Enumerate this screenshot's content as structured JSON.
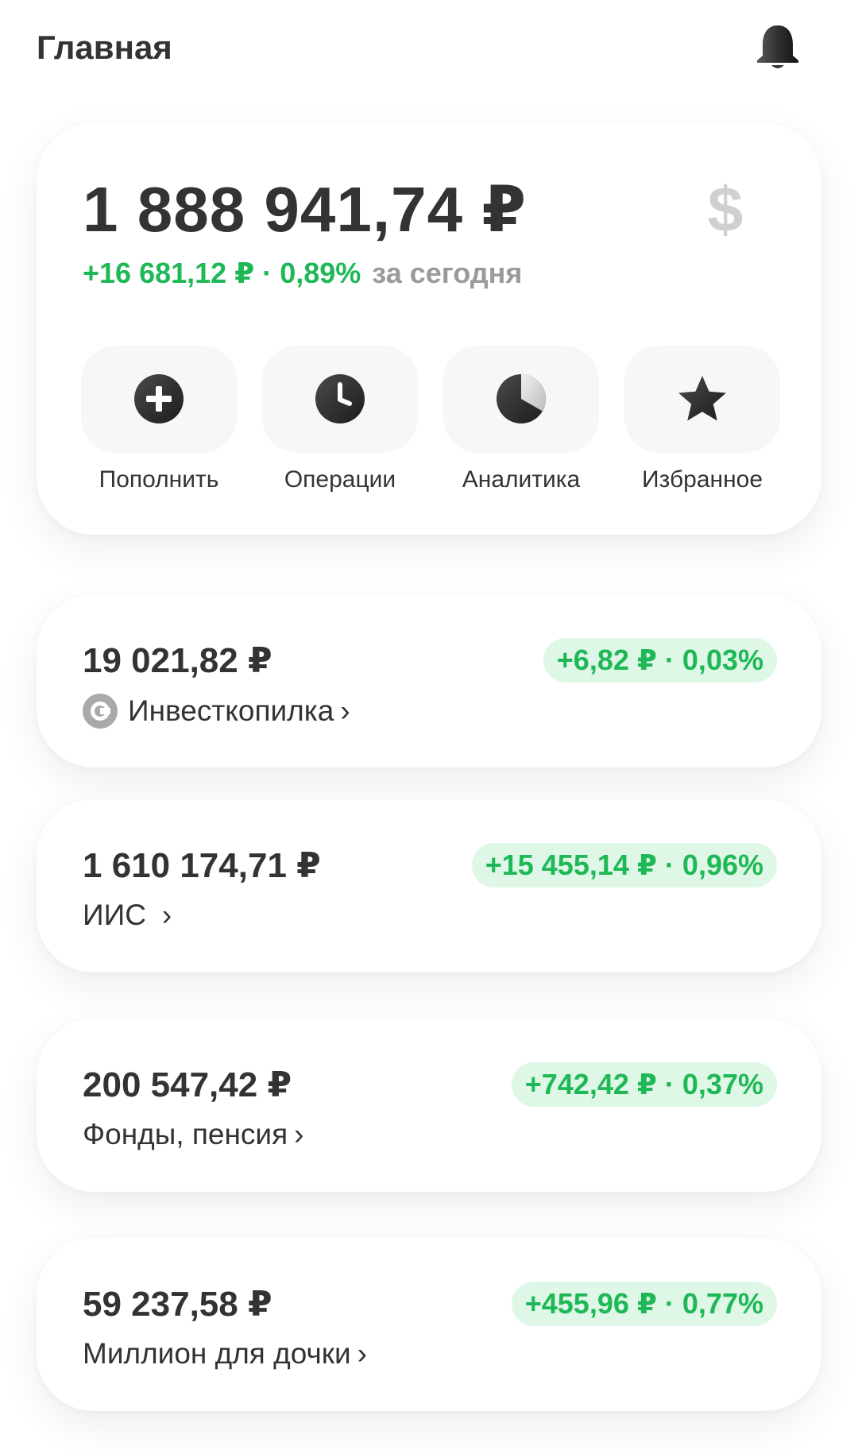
{
  "header": {
    "title": "Главная",
    "notification_icon": "bell-icon"
  },
  "colors": {
    "positive": "#1fb856",
    "positive_bg": "#dff7e6",
    "text": "#333333",
    "muted": "#9a9a9a"
  },
  "summary": {
    "total": "1 888 941,74 ₽",
    "currency_icon": "dollar-icon",
    "change": "+16 681,12 ₽ · 0,89%",
    "period": "за сегодня",
    "actions": [
      {
        "label": "Пополнить",
        "icon": "plus-circle-icon"
      },
      {
        "label": "Операции",
        "icon": "clock-icon"
      },
      {
        "label": "Аналитика",
        "icon": "pie-chart-icon"
      },
      {
        "label": "Избранное",
        "icon": "star-icon"
      }
    ]
  },
  "accounts": [
    {
      "amount": "19 021,82 ₽",
      "name": "Инвесткопилка",
      "chevron": "›",
      "logo": "copilka-logo-icon",
      "change": "+6,82 ₽ · 0,03%"
    },
    {
      "amount": "1 610 174,71 ₽",
      "name": "ИИС",
      "chevron": "›",
      "change": "+15 455,14 ₽ · 0,96%"
    },
    {
      "amount": "200 547,42 ₽",
      "name": "Фонды, пенсия",
      "chevron": "›",
      "change": "+742,42 ₽ · 0,37%"
    },
    {
      "amount": "59 237,58 ₽",
      "name": "Миллион для дочки",
      "chevron": "›",
      "change": "+455,96 ₽ · 0,77%"
    }
  ]
}
